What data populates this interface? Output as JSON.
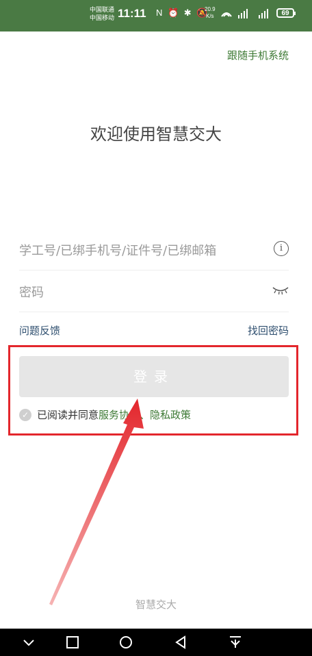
{
  "status_bar": {
    "carrier_1": "中国联通",
    "carrier_2": "中国移动",
    "time": "11:11",
    "icons_text": "N ⏰ ✱ 🔕",
    "speed_value": "20.9",
    "speed_unit": "K/s",
    "battery": "69"
  },
  "header": {
    "follow_system": "跟随手机系统"
  },
  "main": {
    "welcome": "欢迎使用智慧交大",
    "account_placeholder": "学工号/已绑手机号/证件号/已绑邮箱",
    "password_placeholder": "密码",
    "feedback_link": "问题反馈",
    "retrieve_password_link": "找回密码",
    "login_button": "登录",
    "agree_prefix": "已阅读并同意",
    "service_agreement": "服务协议",
    "separator": "、",
    "privacy_policy": "隐私政策"
  },
  "footer": {
    "brand": "智慧交大"
  },
  "annotation": {
    "color": "#e3262c"
  },
  "colors": {
    "status_bar_bg": "#4a7a44",
    "accent_green": "#3e7a35",
    "link_blue": "#2f4f6f",
    "button_disabled": "#e6e6e6"
  }
}
